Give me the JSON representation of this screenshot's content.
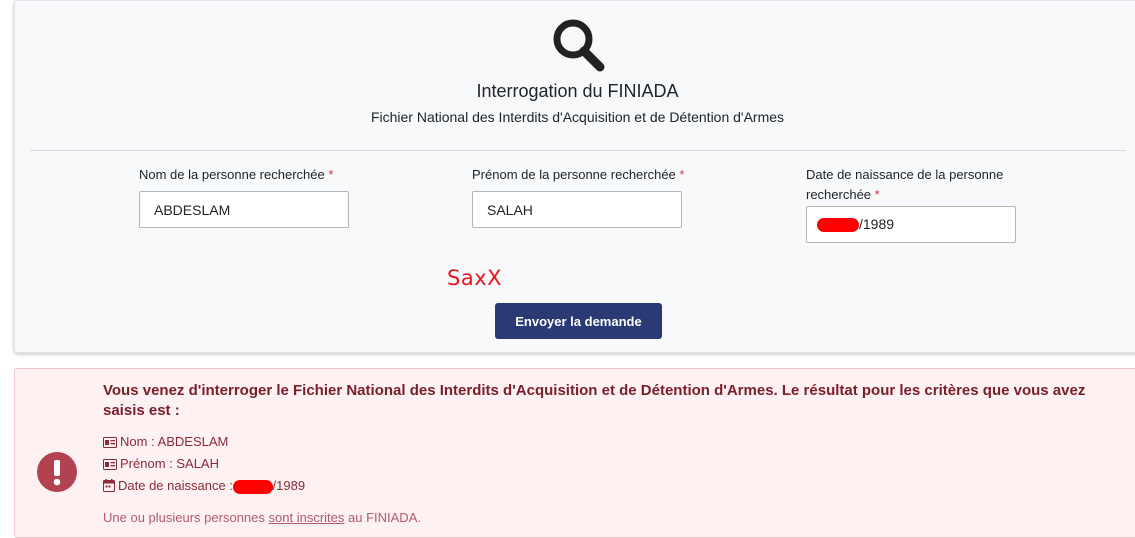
{
  "header": {
    "title": "Interrogation du FINIADA",
    "subtitle": "Fichier National des Interdits d'Acquisition et de Détention d'Armes"
  },
  "form": {
    "required_marker": "*",
    "last_name": {
      "label": "Nom de la personne recherchée",
      "value": "ABDESLAM"
    },
    "first_name": {
      "label": "Prénom de la personne recherchée",
      "value": "SALAH"
    },
    "birth_date": {
      "label_line1": "Date de naissance de la personne",
      "label_line2": "recherchée",
      "value_visible": "/1989"
    },
    "submit_label": "Envoyer la demande"
  },
  "annotation_text": "SaxX",
  "result": {
    "title": "Vous venez d'interroger le Fichier National des Interdits d'Acquisition et de Détention d'Armes. Le résultat pour les critères que vous avez saisis est :",
    "nom_line": "Nom : ABDESLAM",
    "prenom_line": "Prénom : SALAH",
    "date_label": "Date de naissance :",
    "date_value": "/1989",
    "footer_before": "Une ou plusieurs personnes",
    "footer_link": "sont inscrites",
    "footer_after": "au FINIADA."
  },
  "colors": {
    "primary_button": "#2a3a74",
    "required": "#dc3545",
    "alert_text": "#7a1e29",
    "alert_icon": "#b0434f",
    "redaction": "#ff0000"
  },
  "icons": {
    "header": "search-icon",
    "alert": "exclamation-circle-icon",
    "nom": "id-card-icon",
    "prenom": "id-card-icon",
    "date": "calendar-icon"
  }
}
